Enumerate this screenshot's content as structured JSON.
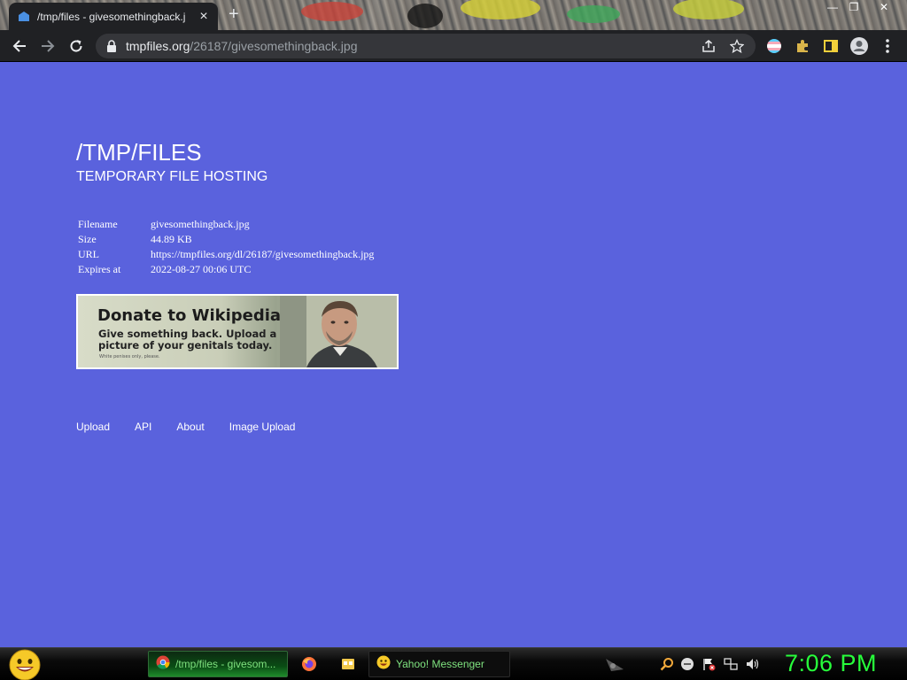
{
  "browser": {
    "tab": {
      "title": "/tmp/files - givesomethingback.j",
      "favicon": "tmpfiles-favicon"
    },
    "new_tab_label": "+",
    "window_controls": {
      "minimize": "—",
      "maximize": "❐",
      "close": "✕"
    },
    "address_bar": {
      "host": "tmpfiles.org",
      "path": "/26187/givesomethingback.jpg"
    }
  },
  "page": {
    "title": "/TMP/FILES",
    "subtitle": "TEMPORARY FILE HOSTING",
    "file_info": [
      {
        "key": "Filename",
        "value": "givesomethingback.jpg"
      },
      {
        "key": "Size",
        "value": "44.89 KB"
      },
      {
        "key": "URL",
        "value": "https://tmpfiles.org/dl/26187/givesomethingback.jpg"
      },
      {
        "key": "Expires at",
        "value": "2022-08-27 00:06 UTC"
      }
    ],
    "banner": {
      "heading": "Donate to Wikipedia",
      "line1": "Give something back. Upload a",
      "line2": "picture of your genitals today.",
      "fine_print": "White penises only, please."
    },
    "footer_links": [
      "Upload",
      "API",
      "About",
      "Image Upload"
    ],
    "background_color": "#5a62dd"
  },
  "taskbar": {
    "tasks": [
      {
        "label": "/tmp/files - givesom...",
        "icon": "chrome-icon"
      },
      {
        "label": "Yahoo! Messenger",
        "icon": "yahoo-messenger-icon"
      }
    ],
    "clock": "7:06 PM",
    "clock_color": "#27ff3b"
  }
}
